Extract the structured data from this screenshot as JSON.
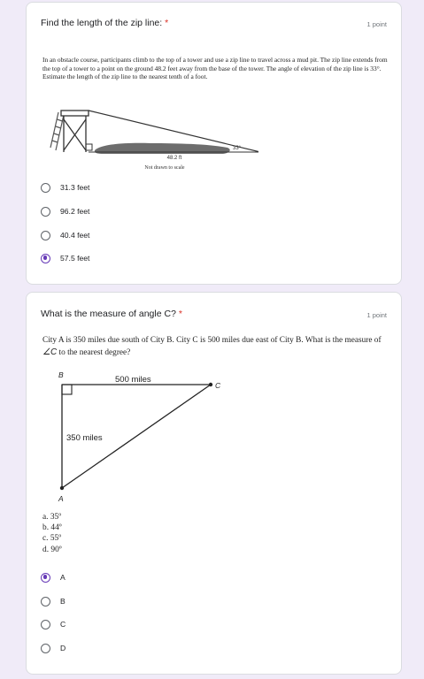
{
  "q1": {
    "title": "Find the length of the zip line:",
    "required": "*",
    "points": "1 point",
    "prompt": "In an obstacle course, participants climb to the top of a tower and use a zip line to travel across a mud pit. The zip line extends from the top of a tower to a point on the ground 48.2 feet away from the base of the tower. The angle of elevation of the zip line is 33°. Estimate the length of the zip line to the nearest tenth of a foot.",
    "figure": {
      "distance_label": "48.2 ft",
      "angle_label": "33°",
      "caption": "Not drawn to scale"
    },
    "options": [
      {
        "label": "31.3 feet",
        "selected": false
      },
      {
        "label": "96.2 feet",
        "selected": false
      },
      {
        "label": "40.4 feet",
        "selected": false
      },
      {
        "label": "57.5 feet",
        "selected": true
      }
    ]
  },
  "q2": {
    "title": "What is the measure of angle C?",
    "required": "*",
    "points": "1 point",
    "prompt_before": "City A is 350 miles due south of City B. City C is 500 miles due east of City B. What is the measure of ",
    "prompt_angle": "∠C",
    "prompt_after": " to the nearest degree?",
    "figure": {
      "label_b": "B",
      "label_c": "C",
      "label_a": "A",
      "top_side": "500 miles",
      "left_side": "350 miles"
    },
    "choices": [
      "a.  35º",
      "b.  44º",
      "c.  55º",
      "d.  90º"
    ],
    "options": [
      {
        "label": "A",
        "selected": true
      },
      {
        "label": "B",
        "selected": false
      },
      {
        "label": "C",
        "selected": false
      },
      {
        "label": "D",
        "selected": false
      }
    ]
  },
  "colors": {
    "accent": "#673ab7",
    "background": "#f0ebf8",
    "required": "#d93025"
  }
}
